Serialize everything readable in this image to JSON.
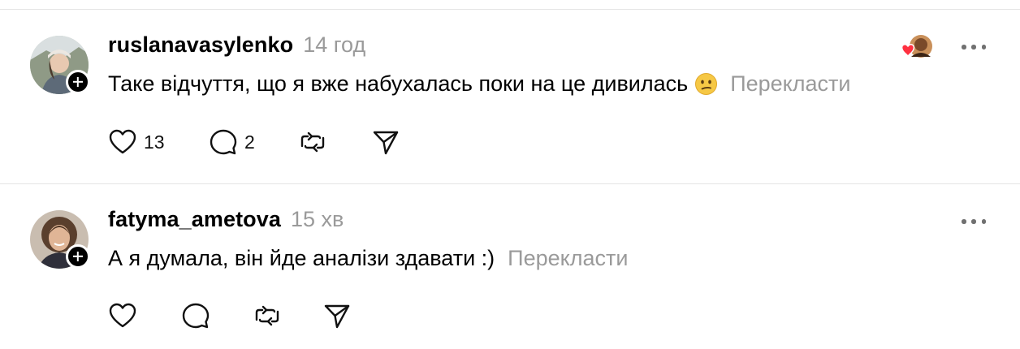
{
  "posts": [
    {
      "username": "ruslanavasylenko",
      "time": "14 год",
      "text": "Таке відчуття, що я вже набухалась поки на це дивилась",
      "emoji": "confused-face",
      "translate_label": "Перекласти",
      "likes": "13",
      "replies": "2",
      "liked_by_visible": true
    },
    {
      "username": "fatyma_ametova",
      "time": "15 хв",
      "text": "А я думала, він йде аналізи здавати :)",
      "translate_label": "Перекласти",
      "likes": "",
      "replies": ""
    }
  ],
  "colors": {
    "muted_text": "#9a9a9a",
    "divider": "#e5e5e5",
    "heart_red": "#ff3040"
  },
  "icons": [
    "heart-icon",
    "comment-icon",
    "repost-icon",
    "share-icon",
    "more-icon",
    "follow-plus-icon"
  ]
}
